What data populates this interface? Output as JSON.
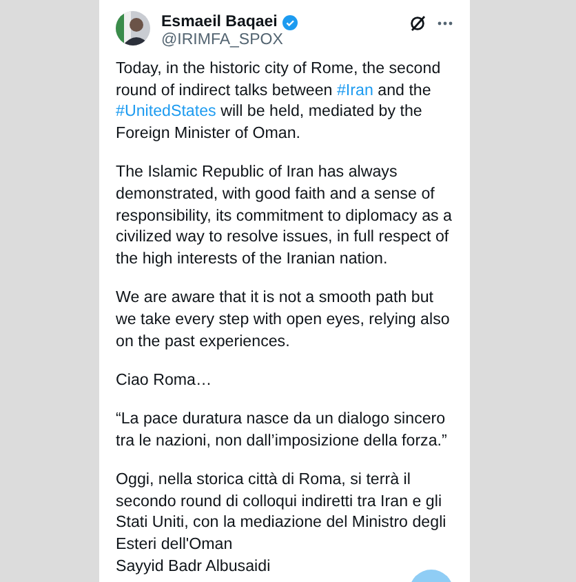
{
  "author": {
    "name": "Esmaeil Baqaei",
    "verified": true,
    "handle": "@IRIMFA_SPOX"
  },
  "paragraphs": [
    [
      {
        "kind": "text",
        "text": "Today, in the historic city of Rome, the second round of indirect talks between "
      },
      {
        "kind": "hashtag",
        "text": "#Iran"
      },
      {
        "kind": "text",
        "text": " and the "
      },
      {
        "kind": "hashtag",
        "text": "#UnitedStates"
      },
      {
        "kind": "text",
        "text": " will be held, mediated by the Foreign Minister of Oman."
      }
    ],
    [
      {
        "kind": "text",
        "text": "The Islamic Republic of Iran has always demonstrated, with good faith and a sense of responsibility, its commitment to diplomacy as a civilized way to resolve issues, in full respect of the high interests of the Iranian nation."
      }
    ],
    [
      {
        "kind": "text",
        "text": "We are aware that it is not a smooth path but we take every step with open eyes, relying also on the past experiences."
      }
    ],
    [
      {
        "kind": "text",
        "text": "Ciao Roma…"
      }
    ],
    [
      {
        "kind": "text",
        "text": "“La pace duratura nasce da un dialogo sincero tra le nazioni, non dall’imposizione della forza.”"
      }
    ],
    [
      {
        "kind": "text",
        "text": "Oggi, nella storica città di Roma, si terrà il secondo round di colloqui indiretti tra Iran e gli Stati Uniti, con la mediazione del Ministro degli Esteri dell'Oman"
      },
      {
        "kind": "break"
      },
      {
        "kind": "text",
        "text": "Sayyid Badr Albusaidi"
      }
    ]
  ]
}
